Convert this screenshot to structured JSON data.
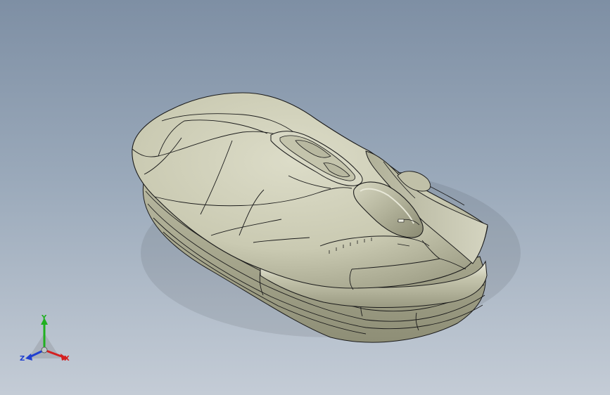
{
  "view": {
    "background_top": "#7e8fa4",
    "background_bottom": "#c4ccd6",
    "model": "mouse-3d-model",
    "model_color": "#cbcbb3",
    "edge_color": "#1b1b1b"
  },
  "triad": {
    "x_label": "X",
    "y_label": "Y",
    "z_label": "Z",
    "x_color": "#d42020",
    "y_color": "#20b020",
    "z_color": "#2040d0"
  }
}
